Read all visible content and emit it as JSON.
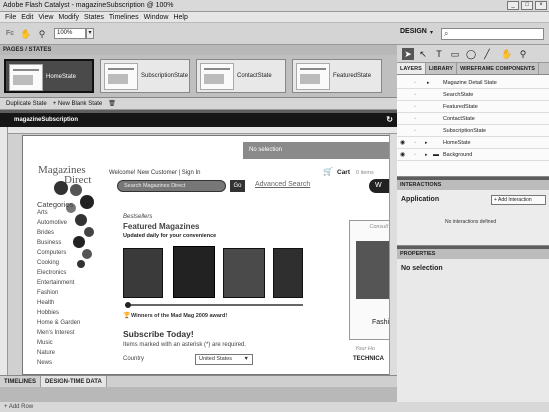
{
  "window": {
    "title": "Adobe Flash Catalyst - magazineSubscription @ 100%",
    "min_label": "_",
    "max_label": "□",
    "close_label": "×"
  },
  "menu": [
    "File",
    "Edit",
    "View",
    "Modify",
    "States",
    "Timelines",
    "Window",
    "Help"
  ],
  "toolbar": {
    "zoom_value": "100%",
    "zoom_arrow": "▾",
    "workspace_label": "DESIGN",
    "workspace_arrow": "▾",
    "search_glyph": "⌕"
  },
  "pages_panel": {
    "header": "PAGES / STATES",
    "states": [
      {
        "label": "HomeState",
        "selected": true
      },
      {
        "label": "SubscriptionState",
        "selected": false
      },
      {
        "label": "ContactState",
        "selected": false
      },
      {
        "label": "FeaturedState",
        "selected": false
      }
    ],
    "duplicate_label": "Duplicate State",
    "new_blank_label": "+ New Blank State"
  },
  "artboard": {
    "title": "magazineSubscription",
    "no_selection": "No selection"
  },
  "site": {
    "logo_line1": "Magazines",
    "logo_line2": "Direct",
    "welcome": "Welcome! New Customer | Sign In",
    "cart": "Cart",
    "cart_count": "0 items",
    "search_placeholder": "Search Magazines Direct",
    "go_label": "Go",
    "advanced_search": "Advanced Search",
    "categories_title": "Categories",
    "categories": [
      "Arts",
      "Automotive",
      "Brides",
      "Business",
      "Computers",
      "Cooking",
      "Electronics",
      "Entertainment",
      "Fashion",
      "Health",
      "Hobbies",
      "Home & Garden",
      "Men's Interest",
      "Music",
      "Nature",
      "News"
    ],
    "bestsellers": "Bestsellers",
    "featured_title": "Featured Magazines",
    "featured_sub": "Updated daily for your convenience",
    "award": "Winners of the Mad Mag 2009 award!",
    "subscribe_title": "Subscribe Today!",
    "required_note": "Items marked with an asterisk (*) are required.",
    "country_label": "Country",
    "country_value": "United States",
    "consult": "Consult",
    "fashion_text": "Fashi",
    "your_host": "Your Ho",
    "technica": "TECHNICA"
  },
  "timelines": {
    "tab1": "TIMELINES",
    "tab2": "DESIGN-TIME DATA",
    "add_row": "Add Row"
  },
  "right_panel": {
    "tabs": [
      "LAYERS",
      "LIBRARY",
      "WIREFRAME COMPONENTS"
    ],
    "layers": [
      {
        "name": "Magazine Detail State",
        "indent": 2,
        "eye": false,
        "arrow": "▸"
      },
      {
        "name": "SearchState",
        "indent": 2,
        "eye": false,
        "arrow": ""
      },
      {
        "name": "FeaturedState",
        "indent": 2,
        "eye": false,
        "arrow": ""
      },
      {
        "name": "ContactState",
        "indent": 2,
        "eye": false,
        "arrow": ""
      },
      {
        "name": "SubscriptionState",
        "indent": 2,
        "eye": false,
        "arrow": ""
      },
      {
        "name": "HomeState",
        "indent": 1,
        "eye": true,
        "arrow": "▸"
      },
      {
        "name": "Background",
        "indent": 1,
        "eye": true,
        "arrow": "▸"
      }
    ],
    "interactions_header": "INTERACTIONS",
    "application_label": "Application",
    "add_interaction": "+ Add Interaction",
    "no_interactions": "No interactions defined",
    "properties_header": "PROPERTIES",
    "no_selection": "No selection"
  }
}
